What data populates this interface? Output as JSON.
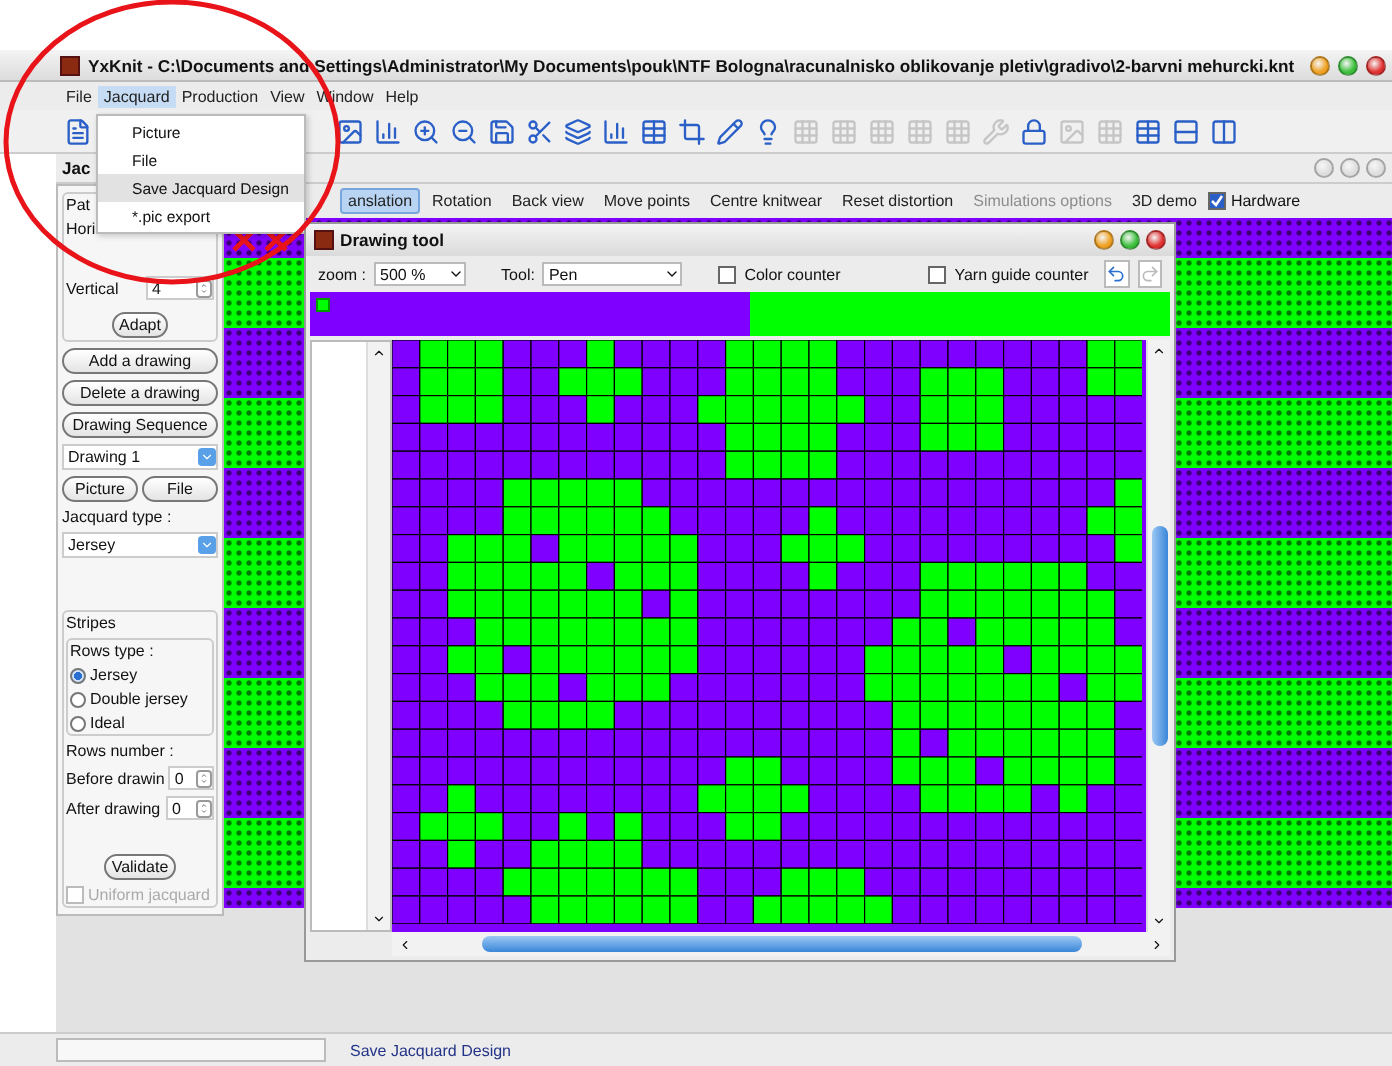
{
  "title_bar": {
    "title": "YxKnit - C:\\Documents and Settings\\Administrator\\My Documents\\pouk\\NTF Bologna\\racunalnisko oblikovanje pletiv\\gradivo\\2-barvni mehurcki.knt"
  },
  "menu": [
    {
      "label": "File",
      "selected": false
    },
    {
      "label": "Jacquard",
      "selected": true
    },
    {
      "label": "Production",
      "selected": false
    },
    {
      "label": "View",
      "selected": false
    },
    {
      "label": "Window",
      "selected": false
    },
    {
      "label": "Help",
      "selected": false
    }
  ],
  "dropdown": [
    {
      "label": "Picture",
      "selected": false
    },
    {
      "label": "File",
      "selected": false
    },
    {
      "label": "Save Jacquard Design",
      "selected": true
    },
    {
      "label": "*.pic export",
      "selected": false
    }
  ],
  "toolbar_start": [
    {
      "kind": "new",
      "disabled": false
    }
  ],
  "toolbar": [
    {
      "kind": "image",
      "disabled": false
    },
    {
      "kind": "chart",
      "disabled": false
    },
    {
      "kind": "zoomin",
      "disabled": false
    },
    {
      "kind": "zoomout",
      "disabled": false
    },
    {
      "kind": "save",
      "disabled": false
    },
    {
      "kind": "cut",
      "disabled": false
    },
    {
      "kind": "layers",
      "disabled": false
    },
    {
      "kind": "chart",
      "disabled": false
    },
    {
      "kind": "table",
      "disabled": false
    },
    {
      "kind": "crop",
      "disabled": false
    },
    {
      "kind": "pencil",
      "disabled": false
    },
    {
      "kind": "bulb",
      "disabled": false
    },
    {
      "kind": "grid",
      "disabled": true
    },
    {
      "kind": "grid",
      "disabled": true
    },
    {
      "kind": "grid",
      "disabled": true
    },
    {
      "kind": "grid",
      "disabled": true
    },
    {
      "kind": "grid",
      "disabled": true
    },
    {
      "kind": "wrench",
      "disabled": true
    },
    {
      "kind": "lock",
      "disabled": false
    },
    {
      "kind": "image",
      "disabled": true
    },
    {
      "kind": "grid",
      "disabled": true
    },
    {
      "kind": "table",
      "disabled": false
    },
    {
      "kind": "rows",
      "disabled": false
    },
    {
      "kind": "columns",
      "disabled": false
    }
  ],
  "panel": {
    "tab": "Jac",
    "group": "Pat",
    "horizontal_label": "Hori",
    "vertical_label": "Vertical",
    "vertical_value": "4",
    "adapt": "Adapt",
    "buttons": [
      "Add a drawing",
      "Delete a drawing",
      "Drawing Sequence"
    ],
    "drawing": "Drawing 1",
    "source_buttons": [
      "Picture",
      "File"
    ],
    "type_label": "Jacquard type :",
    "type_value": "Jersey",
    "stripes": {
      "title": "Stripes",
      "rows_type_label": "Rows type :",
      "rows_types": [
        {
          "label": "Jersey",
          "selected": true
        },
        {
          "label": "Double jersey",
          "selected": false
        },
        {
          "label": "Ideal",
          "selected": false
        }
      ],
      "rows_number_label": "Rows number :",
      "before_label": "Before drawin",
      "before_value": "0",
      "after_label": "After drawing",
      "after_value": "0",
      "validate": "Validate"
    },
    "uniform": {
      "label": "Uniform jacquard",
      "checked": false,
      "disabled": true
    }
  },
  "view_tools": [
    {
      "label": "anslation",
      "selected": true,
      "disabled": false
    },
    {
      "label": "Rotation",
      "selected": false,
      "disabled": false
    },
    {
      "label": "Back view",
      "selected": false,
      "disabled": false
    },
    {
      "label": "Move points",
      "selected": false,
      "disabled": false
    },
    {
      "label": "Centre knitwear",
      "selected": false,
      "disabled": false
    },
    {
      "label": "Reset distortion",
      "selected": false,
      "disabled": false
    },
    {
      "label": "Simulations options",
      "selected": false,
      "disabled": true
    },
    {
      "label": "3D demo",
      "selected": false,
      "disabled": false
    }
  ],
  "hardware": {
    "label": "Hardware",
    "checked": true
  },
  "drawing_tool": {
    "title": "Drawing tool",
    "zoom_label": "zoom :",
    "zoom": "500 %",
    "tool_label": "Tool:",
    "tool": "Pen",
    "color_counter": {
      "label": "Color counter",
      "checked": false
    },
    "yarn_guide_counter": {
      "label": "Yarn guide counter",
      "checked": false
    },
    "redo_disabled": true,
    "palette": [
      {
        "color": "#8000ff"
      },
      {
        "color": "#00ff00"
      }
    ]
  },
  "status": {
    "message": "Save Jacquard Design"
  },
  "annotation": {
    "color": "#e8141a"
  }
}
